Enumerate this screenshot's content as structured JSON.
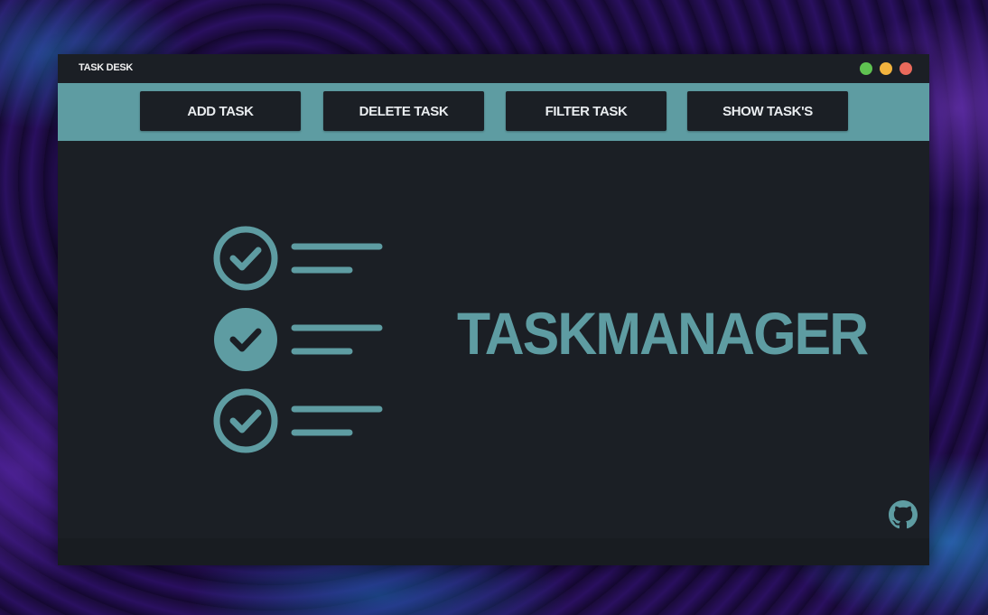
{
  "window": {
    "title": "TASK DESK",
    "controls": [
      "minimize",
      "maximize",
      "close"
    ]
  },
  "toolbar": {
    "buttons": [
      {
        "label": "ADD TASK"
      },
      {
        "label": "DELETE TASK"
      },
      {
        "label": "FILTER TASK"
      },
      {
        "label": "SHOW TASK'S"
      }
    ]
  },
  "main": {
    "title": "TASKMANAGER",
    "illustration": {
      "icon": "checklist-icon",
      "items": 3
    }
  },
  "footer": {
    "icon": "github-icon"
  },
  "colors": {
    "accent": "#5e9ca2",
    "panel": "#1b1f25",
    "footer": "#181c21",
    "dot_green": "#5fc251",
    "dot_yellow": "#f2b33e",
    "dot_red": "#ea6a5c"
  }
}
